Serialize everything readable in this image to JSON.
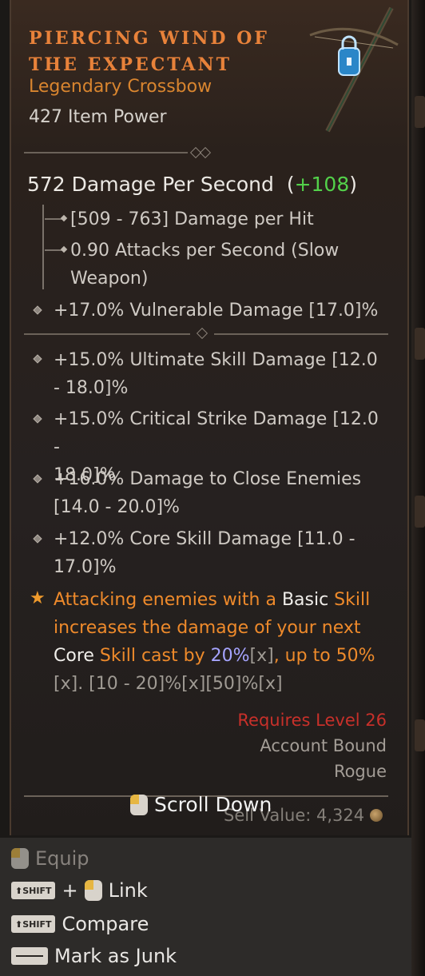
{
  "item": {
    "title_line1": "PIERCING WIND OF",
    "title_line2": "THE EXPECTANT",
    "type": "Legendary Crossbow",
    "item_power": "427 Item Power"
  },
  "stats": {
    "dps_label": "572 Damage Per Second",
    "dps_open": "(",
    "dps_delta": "+108",
    "dps_close": ")",
    "damage_per_hit": "[509 - 763] Damage per Hit",
    "attack_speed_line1": "0.90 Attacks per Second (Slow",
    "attack_speed_line2": "Weapon)",
    "implicit": "+17.0% Vulnerable Damage [17.0]%"
  },
  "affixes": [
    {
      "line1": "+15.0% Ultimate Skill Damage [12.0",
      "line2": "- 18.0]%"
    },
    {
      "line1": "+15.0% Critical Strike Damage [12.0 -",
      "line2": "18.0]%"
    },
    {
      "line1": "+16.0% Damage to Close Enemies",
      "line2": "[14.0 - 20.0]%"
    },
    {
      "line1": "+12.0% Core Skill Damage [11.0 -",
      "line2": "17.0]%"
    }
  ],
  "legendary": {
    "p1": "Attacking enemies with a ",
    "p2": "Basic",
    "p3": " Skill",
    "p4": "increases the damage of your next",
    "p5": "Core",
    "p6": " Skill cast by ",
    "p7": "20%",
    "p8": "[x]",
    "p9": ", up to 50%",
    "p10": "[x]",
    "p11": ". [10 - 20]%[x][50]%[x]"
  },
  "requirements": {
    "level": "Requires Level 26",
    "bound": "Account Bound",
    "class": "Rogue"
  },
  "sell": {
    "scroll_label": "Scroll Down",
    "value": "Sell Value: 4,324"
  },
  "actions": {
    "equip": "Equip",
    "link": "Link",
    "compare": "Compare",
    "junk": "Mark as Junk",
    "shift_key": "SHIFT",
    "plus": "+"
  },
  "colors": {
    "legendary_orange": "#e8823a",
    "positive_green": "#53d14a",
    "requirement_red": "#c8302a",
    "bonus_blue": "#a6a4ff"
  },
  "icons": [
    "crossbow-icon",
    "lock-icon",
    "mouse-icon",
    "shift-key-icon",
    "space-key-icon",
    "coin-icon",
    "star-icon"
  ]
}
